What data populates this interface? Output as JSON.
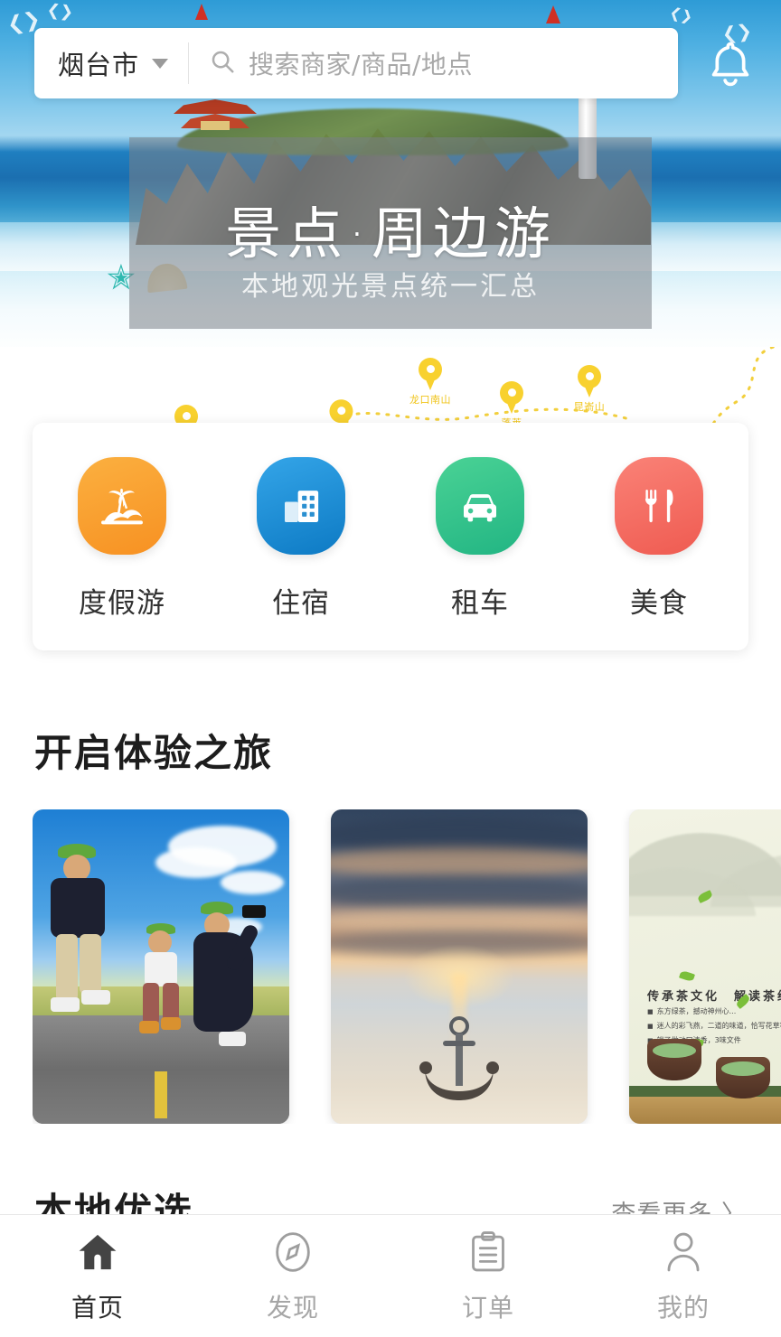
{
  "header": {
    "city": "烟台市",
    "city_caret_icon": "chevron-down-icon",
    "search_icon": "search-icon",
    "search_value": "",
    "search_placeholder": "搜索商家/商品/地点",
    "bell_icon": "bell-icon"
  },
  "banner": {
    "title": "景点·周边游",
    "subtitle": "本地观光景点统一汇总"
  },
  "map_strip": {
    "pins": [
      {
        "label": "",
        "icon": "map-pin-icon"
      },
      {
        "label": "",
        "icon": "map-pin-icon"
      },
      {
        "label": "龙口南山",
        "icon": "map-pin-icon"
      },
      {
        "label": "蓬莱",
        "icon": "map-pin-icon"
      },
      {
        "label": "昆嵛山",
        "icon": "map-pin-icon"
      }
    ]
  },
  "categories": [
    {
      "label": "度假游",
      "icon": "palm-tree-icon",
      "color_start": "#fbb040",
      "color_end": "#f79122"
    },
    {
      "label": "住宿",
      "icon": "building-icon",
      "color_start": "#2196e3",
      "color_end": "#0d7ac4"
    },
    {
      "label": "租车",
      "icon": "car-icon",
      "color_start": "#4ad295",
      "color_end": "#22b583"
    },
    {
      "label": "美食",
      "icon": "cutlery-icon",
      "color_start": "#f9766a",
      "color_end": "#ef5b51"
    }
  ],
  "experience": {
    "title": "开启体验之旅",
    "cards": [
      {
        "name": "family-jumping-road-photo"
      },
      {
        "name": "sunset-anchor-beach-photo"
      },
      {
        "name": "tea-culture-poster"
      }
    ],
    "tea_poster": {
      "char": "茶",
      "headline": "传承茶文化　解读茶经济",
      "lines": [
        "东方绿茶，撼动神州心...",
        "迷人的彩飞燕，二道的味道，恰写花草等陪茶私，",
        "端了做动口清香，3味文件"
      ]
    }
  },
  "local_section": {
    "title": "本地优选",
    "more_label": "查看更多 〉"
  },
  "bottom_nav": {
    "items": [
      {
        "label": "首页",
        "icon": "home-icon",
        "active": true
      },
      {
        "label": "发现",
        "icon": "compass-icon",
        "active": false
      },
      {
        "label": "订单",
        "icon": "clipboard-icon",
        "active": false
      },
      {
        "label": "我的",
        "icon": "person-icon",
        "active": false
      }
    ]
  }
}
